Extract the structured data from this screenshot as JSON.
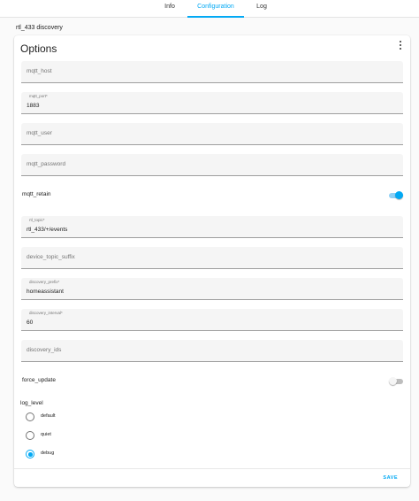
{
  "tabs": [
    {
      "label": "Info",
      "active": false
    },
    {
      "label": "Configuration",
      "active": true
    },
    {
      "label": "Log",
      "active": false
    }
  ],
  "breadcrumb": "rtl_433 discovery",
  "card": {
    "title": "Options",
    "save_label": "SAVE"
  },
  "fields": {
    "mqtt_host": {
      "label": "mqtt_host",
      "value": ""
    },
    "mqtt_port": {
      "label": "mqtt_port*",
      "value": "1883"
    },
    "mqtt_user": {
      "label": "mqtt_user",
      "value": ""
    },
    "mqtt_password": {
      "label": "mqtt_password",
      "value": ""
    },
    "rtl_topic": {
      "label": "rtl_topic*",
      "value": "rtl_433/+/events"
    },
    "device_topic_suffix": {
      "label": "device_topic_suffix",
      "value": ""
    },
    "discovery_prefix": {
      "label": "discovery_prefix*",
      "value": "homeassistant"
    },
    "discovery_interval": {
      "label": "discovery_interval*",
      "value": "60"
    },
    "discovery_ids": {
      "label": "discovery_ids",
      "value": ""
    }
  },
  "switches": {
    "mqtt_retain": {
      "label": "mqtt_retain",
      "on": true
    },
    "force_update": {
      "label": "force_update",
      "on": false
    }
  },
  "log_level": {
    "label": "log_level",
    "options": [
      "default",
      "quiet",
      "debug"
    ],
    "selected": "debug"
  },
  "colors": {
    "accent": "#03a9f4",
    "field_bg": "#f5f5f5",
    "page_bg": "#fafafa"
  },
  "icons": {
    "menu": "more-vert-icon"
  }
}
